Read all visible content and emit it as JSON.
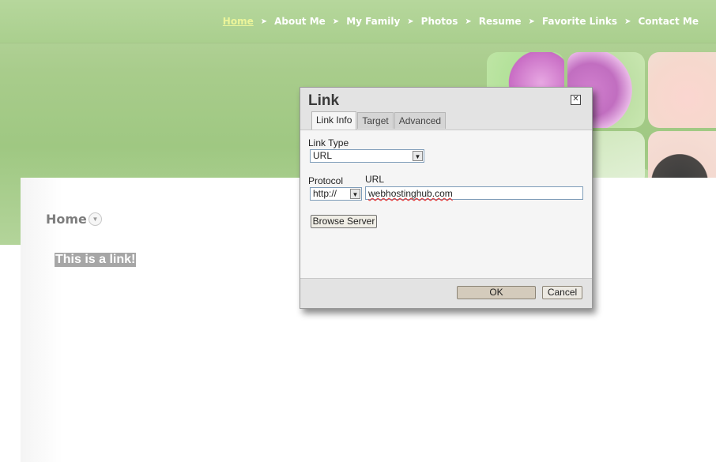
{
  "site": {
    "nav": [
      {
        "label": "Home",
        "active": true
      },
      {
        "label": "About Me",
        "active": false
      },
      {
        "label": "My Family",
        "active": false
      },
      {
        "label": "Photos",
        "active": false
      },
      {
        "label": "Resume",
        "active": false
      },
      {
        "label": "Favorite Links",
        "active": false
      },
      {
        "label": "Contact Me",
        "active": false
      }
    ],
    "nav_separator_icon": "double-chevron-right-icon",
    "page_title": "Home",
    "page_title_toggle_icon": "chevron-down-icon",
    "selected_text": "This is a link!",
    "colors": {
      "header_green": "#aacf8e",
      "active_nav": "#ecf59a",
      "selection": "#a6a6a6"
    }
  },
  "dialog": {
    "title": "Link",
    "close_icon": "close-icon",
    "tabs": [
      "Link Info",
      "Target",
      "Advanced"
    ],
    "active_tab": "Link Info",
    "link_type_label": "Link Type",
    "link_type_value": "URL",
    "protocol_label": "Protocol",
    "protocol_value": "http://",
    "url_label": "URL",
    "url_value": "webhostinghub.com",
    "browse_button": "Browse Server",
    "ok_button": "OK",
    "cancel_button": "Cancel"
  }
}
